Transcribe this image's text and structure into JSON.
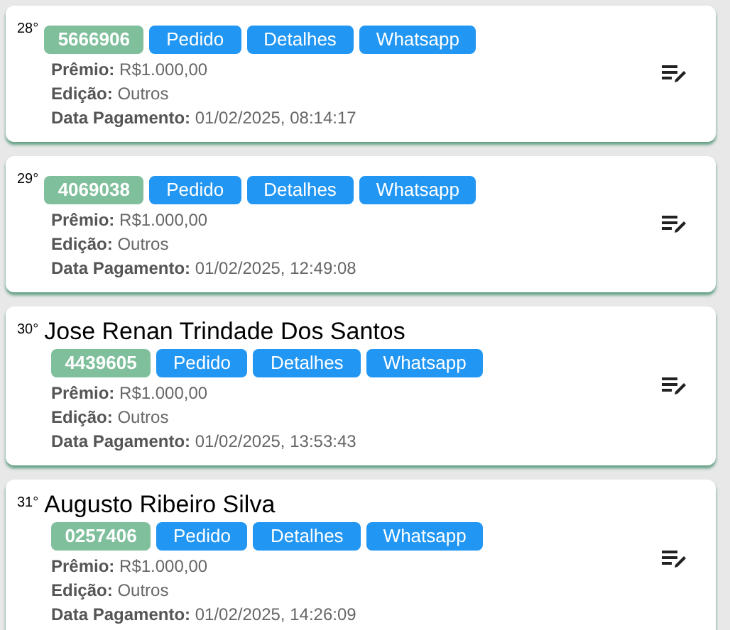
{
  "cards": [
    {
      "rank": "28°",
      "code": "5666906",
      "buttons": [
        "Pedido",
        "Detalhes",
        "Whatsapp"
      ],
      "fields": [
        {
          "label": "Prêmio:",
          "value": "R$1.000,00"
        },
        {
          "label": "Edição:",
          "value": "Outros"
        },
        {
          "label": "Data Pagamento:",
          "value": "01/02/2025, 08:14:17"
        }
      ]
    },
    {
      "rank": "29°",
      "code": "4069038",
      "buttons": [
        "Pedido",
        "Detalhes",
        "Whatsapp"
      ],
      "fields": [
        {
          "label": "Prêmio:",
          "value": "R$1.000,00"
        },
        {
          "label": "Edição:",
          "value": "Outros"
        },
        {
          "label": "Data Pagamento:",
          "value": "01/02/2025, 12:49:08"
        }
      ]
    },
    {
      "rank": "30°",
      "name": "Jose Renan Trindade Dos Santos",
      "code": "4439605",
      "buttons": [
        "Pedido",
        "Detalhes",
        "Whatsapp"
      ],
      "fields": [
        {
          "label": "Prêmio:",
          "value": "R$1.000,00"
        },
        {
          "label": "Edição:",
          "value": "Outros"
        },
        {
          "label": "Data Pagamento:",
          "value": "01/02/2025, 13:53:43"
        }
      ]
    },
    {
      "rank": "31°",
      "name": "Augusto Ribeiro Silva",
      "code": "0257406",
      "buttons": [
        "Pedido",
        "Detalhes",
        "Whatsapp"
      ],
      "fields": [
        {
          "label": "Prêmio:",
          "value": "R$1.000,00"
        },
        {
          "label": "Edição:",
          "value": "Outros"
        },
        {
          "label": "Data Pagamento:",
          "value": "01/02/2025, 14:26:09"
        }
      ]
    }
  ]
}
